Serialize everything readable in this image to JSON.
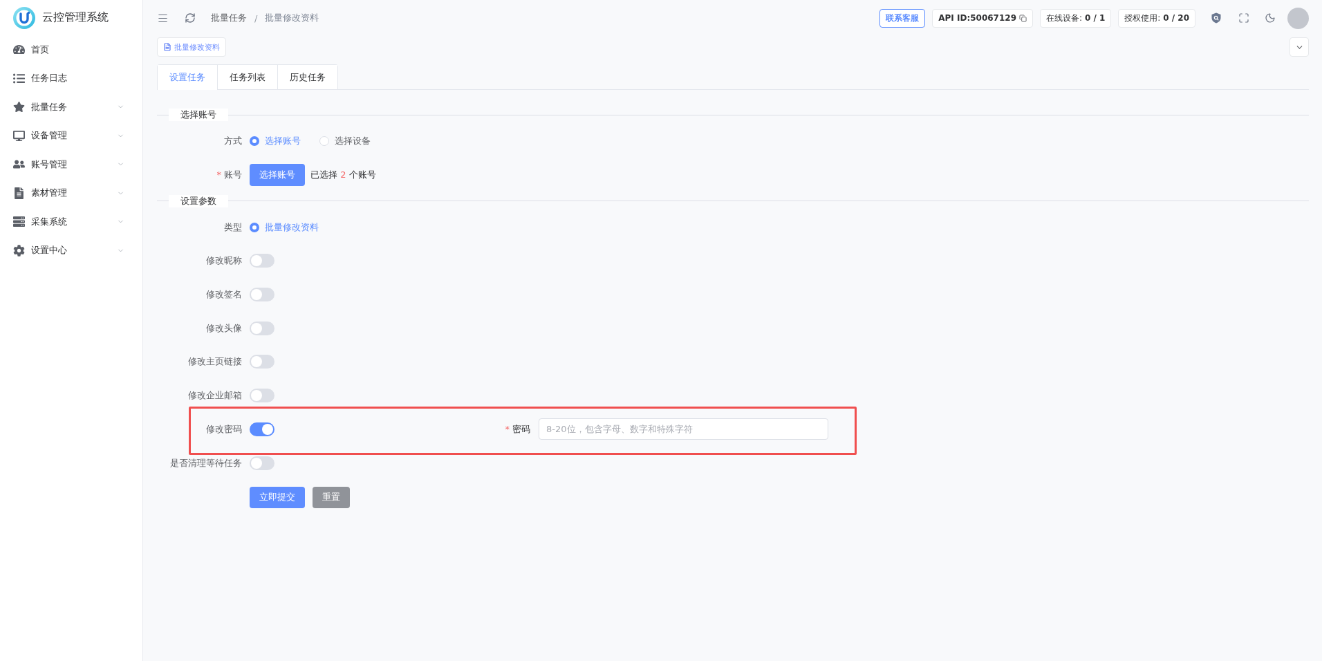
{
  "brand": {
    "title": "云控管理系统"
  },
  "sidebar": {
    "items": [
      {
        "label": "首页",
        "expandable": false,
        "selected": false
      },
      {
        "label": "任务日志",
        "expandable": false,
        "selected": false
      },
      {
        "label": "批量任务",
        "expandable": true,
        "selected": false
      },
      {
        "label": "设备管理",
        "expandable": true,
        "selected": false
      },
      {
        "label": "账号管理",
        "expandable": true,
        "selected": false
      },
      {
        "label": "素材管理",
        "expandable": true,
        "selected": false
      },
      {
        "label": "采集系统",
        "expandable": true,
        "selected": false
      },
      {
        "label": "设置中心",
        "expandable": true,
        "selected": false
      }
    ]
  },
  "header": {
    "breadcrumb": {
      "items": [
        "批量任务",
        "批量修改资料"
      ],
      "separator": "/"
    },
    "contact_button": "联系客服",
    "api_id": "API ID:50067129",
    "stats": [
      {
        "label": "在线设备:",
        "value": "0 / 1"
      },
      {
        "label": "授权使用:",
        "value": "0 / 20"
      }
    ]
  },
  "tags": [
    {
      "label": "批量修改资料",
      "selected": true
    }
  ],
  "tabs": [
    {
      "label": "设置任务",
      "selected": true
    },
    {
      "label": "任务列表",
      "selected": false
    },
    {
      "label": "历史任务",
      "selected": false
    }
  ],
  "form": {
    "sections": [
      {
        "title": "选择账号",
        "fields": [
          {
            "kind": "radio",
            "label": "方式",
            "options": [
              {
                "label": "选择账号",
                "selected": true
              },
              {
                "label": "选择设备",
                "selected": false
              }
            ]
          },
          {
            "kind": "picker",
            "label": "账号",
            "required_mark": "*",
            "button": "选择账号",
            "summary": {
              "prefix": "已选择",
              "count": "2",
              "suffix": "个账号"
            }
          }
        ]
      },
      {
        "title": "设置参数",
        "fields": [
          {
            "kind": "radio",
            "label": "类型",
            "options": [
              {
                "label": "批量修改资料",
                "selected": true
              }
            ]
          },
          {
            "kind": "switch",
            "label": "修改昵称",
            "on": false,
            "highlighted": false
          },
          {
            "kind": "switch",
            "label": "修改签名",
            "on": false,
            "highlighted": false
          },
          {
            "kind": "switch",
            "label": "修改头像",
            "on": false,
            "highlighted": false
          },
          {
            "kind": "switch",
            "label": "修改主页链接",
            "on": false,
            "highlighted": false
          },
          {
            "kind": "switch",
            "label": "修改企业邮箱",
            "on": false,
            "highlighted": false
          },
          {
            "kind": "switch",
            "label": "修改密码",
            "on": true,
            "highlighted": true,
            "extra": {
              "label": "密码",
              "required_mark": "*",
              "placeholder": "8-20位，包含字母、数字和特殊字符"
            }
          },
          {
            "kind": "switch",
            "label": "是否清理等待任务",
            "on": false,
            "highlighted": false
          }
        ]
      }
    ],
    "actions": [
      {
        "kind": "primary",
        "label": "立即提交"
      },
      {
        "kind": "secondary",
        "label": "重置"
      }
    ]
  }
}
